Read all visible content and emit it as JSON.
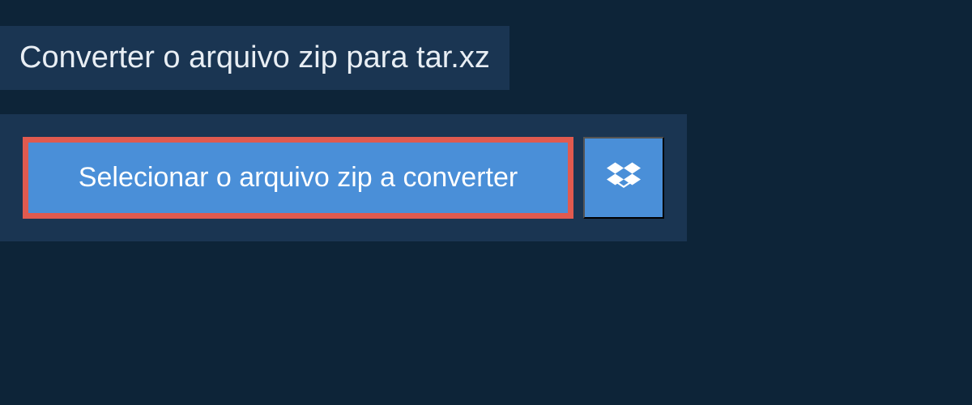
{
  "header": {
    "title": "Converter o arquivo zip para tar.xz"
  },
  "actions": {
    "select_file_label": "Selecionar o arquivo zip a converter"
  }
}
